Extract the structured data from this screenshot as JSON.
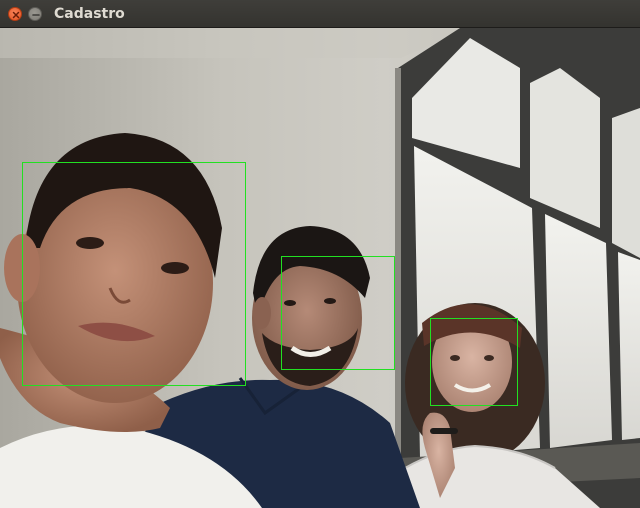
{
  "window": {
    "title": "Cadastro",
    "close_icon": "close-icon",
    "minimize_icon": "minimize-icon"
  },
  "camera": {
    "face_box_color": "#22e022",
    "detected_faces": 3
  }
}
